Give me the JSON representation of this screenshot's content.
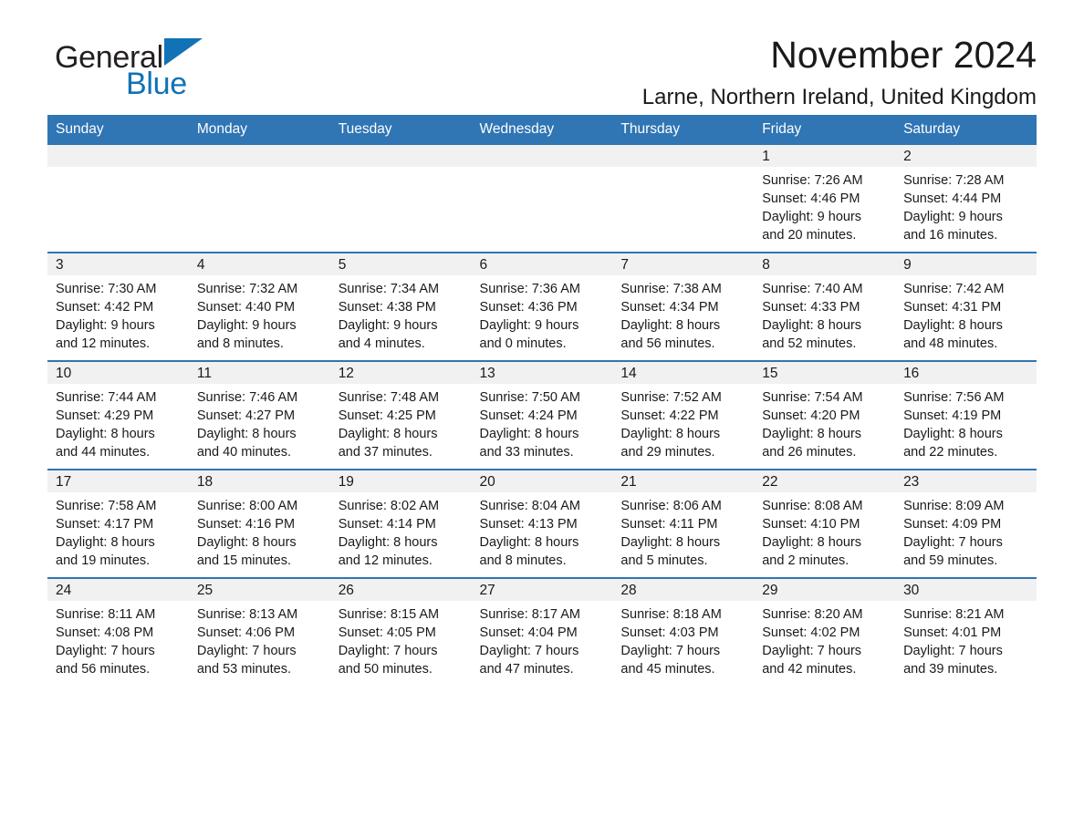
{
  "brand": {
    "name_part1": "General",
    "name_part2": "Blue",
    "accent_color": "#1272b6"
  },
  "header": {
    "month_title": "November 2024",
    "location": "Larne, Northern Ireland, United Kingdom",
    "header_bg": "#3075b4"
  },
  "weekdays": [
    "Sunday",
    "Monday",
    "Tuesday",
    "Wednesday",
    "Thursday",
    "Friday",
    "Saturday"
  ],
  "weeks": [
    [
      {
        "day": "",
        "lines": []
      },
      {
        "day": "",
        "lines": []
      },
      {
        "day": "",
        "lines": []
      },
      {
        "day": "",
        "lines": []
      },
      {
        "day": "",
        "lines": []
      },
      {
        "day": "1",
        "lines": [
          "Sunrise: 7:26 AM",
          "Sunset: 4:46 PM",
          "Daylight: 9 hours",
          "and 20 minutes."
        ]
      },
      {
        "day": "2",
        "lines": [
          "Sunrise: 7:28 AM",
          "Sunset: 4:44 PM",
          "Daylight: 9 hours",
          "and 16 minutes."
        ]
      }
    ],
    [
      {
        "day": "3",
        "lines": [
          "Sunrise: 7:30 AM",
          "Sunset: 4:42 PM",
          "Daylight: 9 hours",
          "and 12 minutes."
        ]
      },
      {
        "day": "4",
        "lines": [
          "Sunrise: 7:32 AM",
          "Sunset: 4:40 PM",
          "Daylight: 9 hours",
          "and 8 minutes."
        ]
      },
      {
        "day": "5",
        "lines": [
          "Sunrise: 7:34 AM",
          "Sunset: 4:38 PM",
          "Daylight: 9 hours",
          "and 4 minutes."
        ]
      },
      {
        "day": "6",
        "lines": [
          "Sunrise: 7:36 AM",
          "Sunset: 4:36 PM",
          "Daylight: 9 hours",
          "and 0 minutes."
        ]
      },
      {
        "day": "7",
        "lines": [
          "Sunrise: 7:38 AM",
          "Sunset: 4:34 PM",
          "Daylight: 8 hours",
          "and 56 minutes."
        ]
      },
      {
        "day": "8",
        "lines": [
          "Sunrise: 7:40 AM",
          "Sunset: 4:33 PM",
          "Daylight: 8 hours",
          "and 52 minutes."
        ]
      },
      {
        "day": "9",
        "lines": [
          "Sunrise: 7:42 AM",
          "Sunset: 4:31 PM",
          "Daylight: 8 hours",
          "and 48 minutes."
        ]
      }
    ],
    [
      {
        "day": "10",
        "lines": [
          "Sunrise: 7:44 AM",
          "Sunset: 4:29 PM",
          "Daylight: 8 hours",
          "and 44 minutes."
        ]
      },
      {
        "day": "11",
        "lines": [
          "Sunrise: 7:46 AM",
          "Sunset: 4:27 PM",
          "Daylight: 8 hours",
          "and 40 minutes."
        ]
      },
      {
        "day": "12",
        "lines": [
          "Sunrise: 7:48 AM",
          "Sunset: 4:25 PM",
          "Daylight: 8 hours",
          "and 37 minutes."
        ]
      },
      {
        "day": "13",
        "lines": [
          "Sunrise: 7:50 AM",
          "Sunset: 4:24 PM",
          "Daylight: 8 hours",
          "and 33 minutes."
        ]
      },
      {
        "day": "14",
        "lines": [
          "Sunrise: 7:52 AM",
          "Sunset: 4:22 PM",
          "Daylight: 8 hours",
          "and 29 minutes."
        ]
      },
      {
        "day": "15",
        "lines": [
          "Sunrise: 7:54 AM",
          "Sunset: 4:20 PM",
          "Daylight: 8 hours",
          "and 26 minutes."
        ]
      },
      {
        "day": "16",
        "lines": [
          "Sunrise: 7:56 AM",
          "Sunset: 4:19 PM",
          "Daylight: 8 hours",
          "and 22 minutes."
        ]
      }
    ],
    [
      {
        "day": "17",
        "lines": [
          "Sunrise: 7:58 AM",
          "Sunset: 4:17 PM",
          "Daylight: 8 hours",
          "and 19 minutes."
        ]
      },
      {
        "day": "18",
        "lines": [
          "Sunrise: 8:00 AM",
          "Sunset: 4:16 PM",
          "Daylight: 8 hours",
          "and 15 minutes."
        ]
      },
      {
        "day": "19",
        "lines": [
          "Sunrise: 8:02 AM",
          "Sunset: 4:14 PM",
          "Daylight: 8 hours",
          "and 12 minutes."
        ]
      },
      {
        "day": "20",
        "lines": [
          "Sunrise: 8:04 AM",
          "Sunset: 4:13 PM",
          "Daylight: 8 hours",
          "and 8 minutes."
        ]
      },
      {
        "day": "21",
        "lines": [
          "Sunrise: 8:06 AM",
          "Sunset: 4:11 PM",
          "Daylight: 8 hours",
          "and 5 minutes."
        ]
      },
      {
        "day": "22",
        "lines": [
          "Sunrise: 8:08 AM",
          "Sunset: 4:10 PM",
          "Daylight: 8 hours",
          "and 2 minutes."
        ]
      },
      {
        "day": "23",
        "lines": [
          "Sunrise: 8:09 AM",
          "Sunset: 4:09 PM",
          "Daylight: 7 hours",
          "and 59 minutes."
        ]
      }
    ],
    [
      {
        "day": "24",
        "lines": [
          "Sunrise: 8:11 AM",
          "Sunset: 4:08 PM",
          "Daylight: 7 hours",
          "and 56 minutes."
        ]
      },
      {
        "day": "25",
        "lines": [
          "Sunrise: 8:13 AM",
          "Sunset: 4:06 PM",
          "Daylight: 7 hours",
          "and 53 minutes."
        ]
      },
      {
        "day": "26",
        "lines": [
          "Sunrise: 8:15 AM",
          "Sunset: 4:05 PM",
          "Daylight: 7 hours",
          "and 50 minutes."
        ]
      },
      {
        "day": "27",
        "lines": [
          "Sunrise: 8:17 AM",
          "Sunset: 4:04 PM",
          "Daylight: 7 hours",
          "and 47 minutes."
        ]
      },
      {
        "day": "28",
        "lines": [
          "Sunrise: 8:18 AM",
          "Sunset: 4:03 PM",
          "Daylight: 7 hours",
          "and 45 minutes."
        ]
      },
      {
        "day": "29",
        "lines": [
          "Sunrise: 8:20 AM",
          "Sunset: 4:02 PM",
          "Daylight: 7 hours",
          "and 42 minutes."
        ]
      },
      {
        "day": "30",
        "lines": [
          "Sunrise: 8:21 AM",
          "Sunset: 4:01 PM",
          "Daylight: 7 hours",
          "and 39 minutes."
        ]
      }
    ]
  ]
}
